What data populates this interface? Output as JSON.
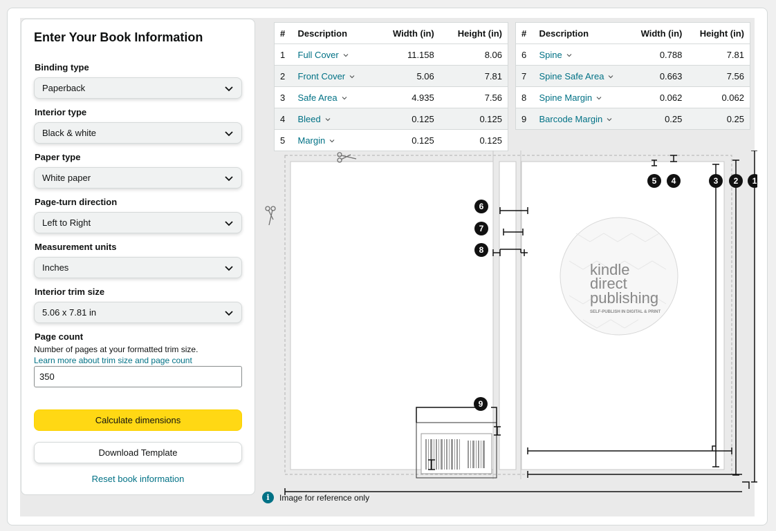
{
  "form": {
    "title": "Enter Your Book Information",
    "binding_type": {
      "label": "Binding type",
      "value": "Paperback"
    },
    "interior_type": {
      "label": "Interior type",
      "value": "Black & white"
    },
    "paper_type": {
      "label": "Paper type",
      "value": "White paper"
    },
    "page_turn": {
      "label": "Page-turn direction",
      "value": "Left to Right"
    },
    "units": {
      "label": "Measurement units",
      "value": "Inches"
    },
    "trim_size": {
      "label": "Interior trim size",
      "value": "5.06 x 7.81 in"
    },
    "page_count": {
      "label": "Page count",
      "help": "Number of pages at your formatted trim size.",
      "help_link": "Learn more about trim size and page count",
      "value": "350"
    },
    "calculate_label": "Calculate dimensions",
    "download_label": "Download Template",
    "reset_label": "Reset book information"
  },
  "table_headers": {
    "num": "#",
    "desc": "Description",
    "width": "Width (in)",
    "height": "Height (in)"
  },
  "table_left": [
    {
      "num": "1",
      "desc": "Full Cover",
      "width": "11.158",
      "height": "8.06"
    },
    {
      "num": "2",
      "desc": "Front Cover",
      "width": "5.06",
      "height": "7.81"
    },
    {
      "num": "3",
      "desc": "Safe Area",
      "width": "4.935",
      "height": "7.56"
    },
    {
      "num": "4",
      "desc": "Bleed",
      "width": "0.125",
      "height": "0.125"
    },
    {
      "num": "5",
      "desc": "Margin",
      "width": "0.125",
      "height": "0.125"
    }
  ],
  "table_right": [
    {
      "num": "6",
      "desc": "Spine",
      "width": "0.788",
      "height": "7.81"
    },
    {
      "num": "7",
      "desc": "Spine Safe Area",
      "width": "0.663",
      "height": "7.56"
    },
    {
      "num": "8",
      "desc": "Spine Margin",
      "width": "0.062",
      "height": "0.062"
    },
    {
      "num": "9",
      "desc": "Barcode Margin",
      "width": "0.25",
      "height": "0.25"
    }
  ],
  "diagram": {
    "logo_line1": "kindle",
    "logo_line2": "direct",
    "logo_line3": "publishing",
    "logo_tagline": "SELF-PUBLISH IN DIGITAL & PRINT",
    "markers": [
      "1",
      "2",
      "3",
      "4",
      "5",
      "6",
      "7",
      "8",
      "9"
    ]
  },
  "note": "Image for reference only",
  "icons": {
    "chevron": "chevron-down-icon",
    "info": "info-icon",
    "scissors": "scissors-icon"
  },
  "colors": {
    "accent": "#007185",
    "primary_button": "#ffd814"
  }
}
